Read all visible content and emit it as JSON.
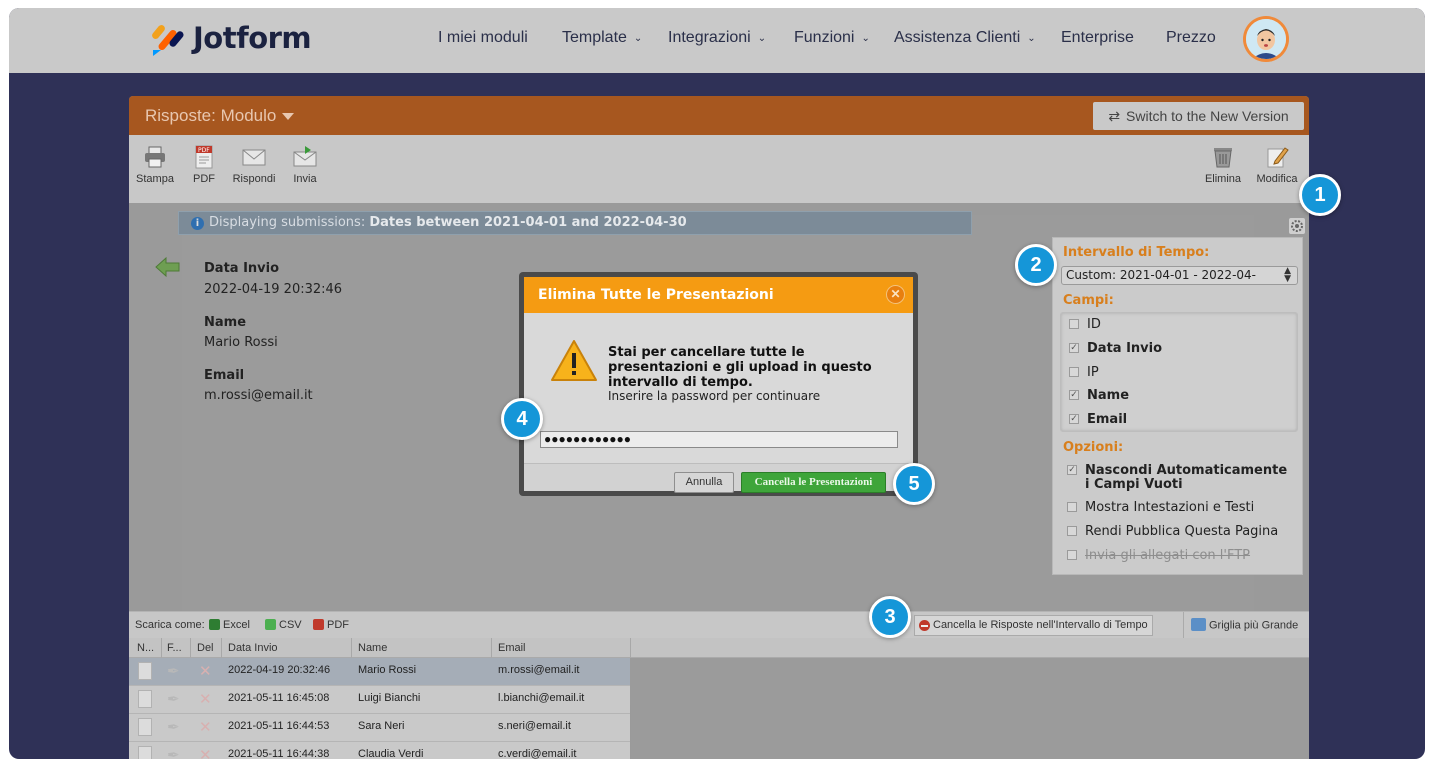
{
  "brand": {
    "name": "Jotform"
  },
  "nav": {
    "items": [
      {
        "label": "I miei moduli",
        "dropdown": false
      },
      {
        "label": "Template",
        "dropdown": true
      },
      {
        "label": "Integrazioni",
        "dropdown": true
      },
      {
        "label": "Funzioni",
        "dropdown": true
      },
      {
        "label": "Assistenza Clienti",
        "dropdown": true
      },
      {
        "label": "Enterprise",
        "dropdown": false
      },
      {
        "label": "Prezzo",
        "dropdown": false
      }
    ]
  },
  "app": {
    "title": "Risposte: Modulo",
    "switch_label": "Switch to the New Version",
    "toolbar": {
      "left": [
        {
          "label": "Stampa",
          "icon": "printer-icon"
        },
        {
          "label": "PDF",
          "icon": "pdf-icon"
        },
        {
          "label": "Rispondi",
          "icon": "reply-mail-icon"
        },
        {
          "label": "Invia",
          "icon": "forward-mail-icon"
        }
      ],
      "right": [
        {
          "label": "Elimina",
          "icon": "trash-icon"
        },
        {
          "label": "Modifica",
          "icon": "edit-icon"
        }
      ]
    },
    "infobar": {
      "prefix": "Displaying submissions:",
      "range": "Dates between 2021-04-01 and 2022-04-30"
    },
    "submission": {
      "fields": [
        {
          "label": "Data Invio",
          "value": "2022-04-19 20:32:46"
        },
        {
          "label": "Name",
          "value": "Mario Rossi"
        },
        {
          "label": "Email",
          "value": "m.rossi@email.it"
        }
      ]
    },
    "sidepanel": {
      "time_heading": "Intervallo di Tempo:",
      "time_value": "Custom: 2021-04-01 - 2022-04-",
      "fields_heading": "Campi:",
      "fields": [
        {
          "label": "ID",
          "checked": false,
          "bold": false
        },
        {
          "label": "Data Invio",
          "checked": true,
          "bold": true
        },
        {
          "label": "IP",
          "checked": false,
          "bold": false
        },
        {
          "label": "Name",
          "checked": true,
          "bold": true
        },
        {
          "label": "Email",
          "checked": true,
          "bold": true
        }
      ],
      "options_heading": "Opzioni:",
      "options": [
        {
          "label": "Nascondi Automaticamente",
          "label2": "i Campi Vuoti",
          "checked": true,
          "bold": true
        },
        {
          "label": "Mostra Intestazioni e Testi",
          "checked": false
        },
        {
          "label": "Rendi Pubblica Questa Pagina",
          "checked": false
        },
        {
          "label": "Invia gli allegati con l'FTP",
          "checked": false,
          "disabled": true
        }
      ]
    },
    "gridbar": {
      "download_label": "Scarica come:",
      "excel": "Excel",
      "csv": "CSV",
      "pdf": "PDF",
      "delete_range": "Cancella le Risposte nell'Intervallo di Tempo",
      "bigger_grid": "Griglia più Grande"
    },
    "grid": {
      "columns": [
        "N...",
        "F...",
        "Del",
        "Data Invio",
        "Name",
        "Email"
      ],
      "rows": [
        {
          "date": "2022-04-19 20:32:46",
          "name": "Mario Rossi",
          "email": "m.rossi@email.it",
          "selected": true
        },
        {
          "date": "2021-05-11 16:45:08",
          "name": "Luigi Bianchi",
          "email": "l.bianchi@email.it",
          "selected": false
        },
        {
          "date": "2021-05-11 16:44:53",
          "name": "Sara Neri",
          "email": "s.neri@email.it",
          "selected": false
        },
        {
          "date": "2021-05-11 16:44:38",
          "name": "Claudia Verdi",
          "email": "c.verdi@email.it",
          "selected": false
        }
      ]
    }
  },
  "modal": {
    "title": "Elimina Tutte le Presentazioni",
    "message": "Stai per cancellare tutte le presentazioni e gli upload in questo intervallo di tempo.",
    "sub": "Inserire la password per continuare",
    "password_value": "●●●●●●●●●●●●",
    "cancel_label": "Annulla",
    "confirm_label": "Cancella le Presentazioni"
  },
  "callouts": [
    "1",
    "2",
    "3",
    "4",
    "5"
  ],
  "colors": {
    "accent_orange": "#f59b12",
    "header_brown": "#a7571f",
    "badge_blue": "#1596d8",
    "confirm_green": "#3ea53a",
    "backdrop": "#2f3157"
  }
}
